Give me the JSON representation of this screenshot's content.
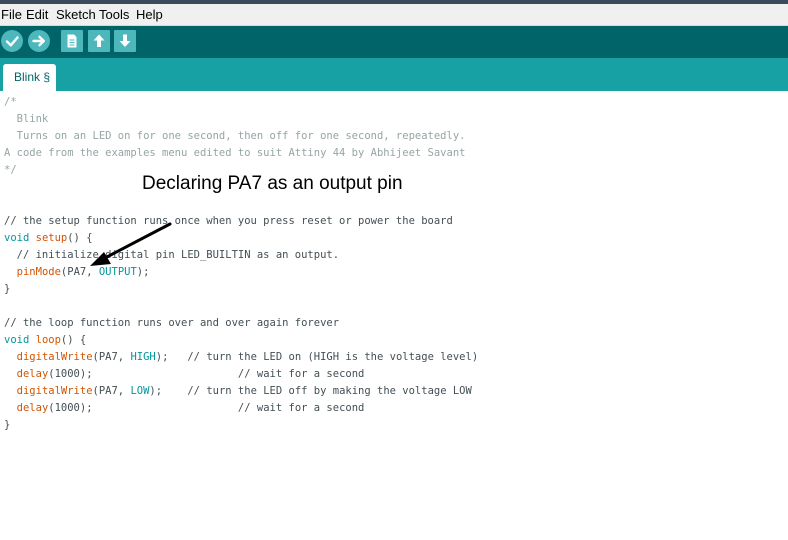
{
  "menu": {
    "file": "File",
    "edit": "Edit",
    "sketch": "Sketch",
    "tools": "Tools",
    "help": "Help"
  },
  "toolbar": {
    "verify_icon": "check-icon",
    "upload_icon": "arrow-right-icon",
    "new_icon": "document-icon",
    "open_icon": "arrow-up-icon",
    "save_icon": "arrow-down-icon"
  },
  "tab": {
    "label": "Blink §"
  },
  "code": {
    "l1": "/*",
    "l2": "  Blink",
    "l3": "  Turns on an LED on for one second, then off for one second, repeatedly.",
    "l4": "A code from the examples menu edited to suit Attiny 44 by Abhijeet Savant",
    "l5": "*/",
    "l8": "// the setup function runs once when you press reset or power the board",
    "l9_kw": "void",
    "l9_fn": "setup",
    "l9_rest": "() {",
    "l10": "  // initialize digital pin LED_BUILTIN as an output.",
    "l11_fn": "pinMode",
    "l11_a": "(PA7, ",
    "l11_const": "OUTPUT",
    "l11_b": ");",
    "l12": "}",
    "l14": "// the loop function runs over and over again forever",
    "l15_kw": "void",
    "l15_fn": "loop",
    "l15_rest": "() {",
    "l16_fn": "digitalWrite",
    "l16_a": "(PA7, ",
    "l16_const": "HIGH",
    "l16_b": ");   ",
    "l16_cmt": "// turn the LED on (HIGH is the voltage level)",
    "l17_fn": "delay",
    "l17_a": "(1000);                       ",
    "l17_cmt": "// wait for a second",
    "l18_fn": "digitalWrite",
    "l18_a": "(PA7, ",
    "l18_const": "LOW",
    "l18_b": ");    ",
    "l18_cmt": "// turn the LED off by making the voltage LOW",
    "l19_fn": "delay",
    "l19_a": "(1000);                       ",
    "l19_cmt": "// wait for a second",
    "l20": "}"
  },
  "annotation": {
    "text": "Declaring PA7 as an output pin"
  },
  "colors": {
    "toolbar": "#006468",
    "tabstrip": "#17a1a5",
    "button": "#4db7bb",
    "comment": "#95a5a6",
    "keyword": "#00979c",
    "function": "#d35400"
  }
}
